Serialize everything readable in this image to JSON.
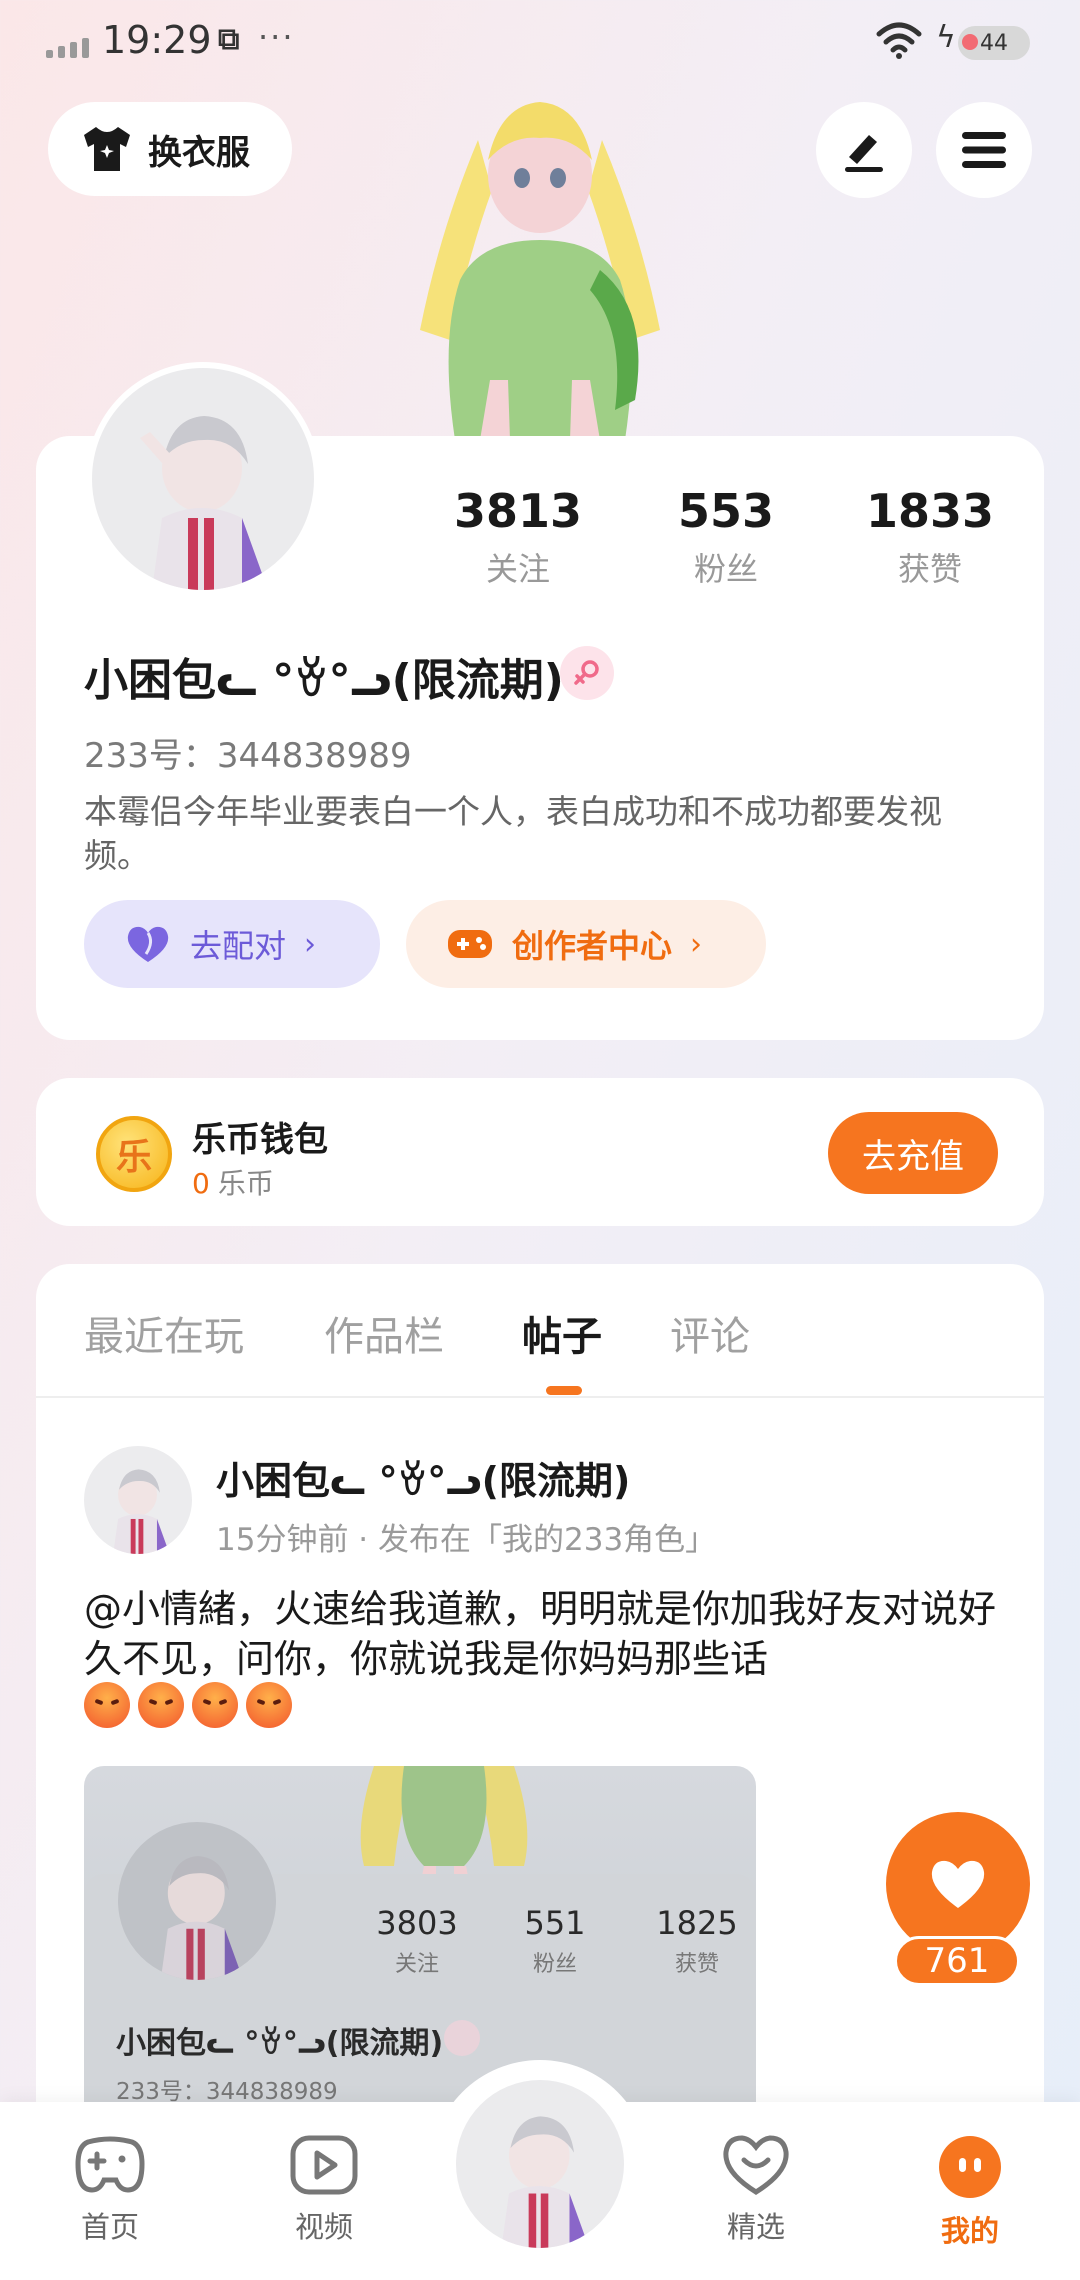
{
  "status_bar": {
    "time": "19:29",
    "battery": "44"
  },
  "top": {
    "outfit_label": "换衣服"
  },
  "profile": {
    "stats": [
      {
        "num": "3813",
        "label": "关注"
      },
      {
        "num": "553",
        "label": "粉丝"
      },
      {
        "num": "1833",
        "label": "获赞"
      }
    ],
    "name": "小困包ᓚ °ꈊ°ᓗ(限流期)",
    "uid": "233号：344838989",
    "bio": "本霉侣今年毕业要表白一个人，表白成功和不成功都要发视频。",
    "match_label": "去配对",
    "creator_label": "创作者中心"
  },
  "wallet": {
    "title": "乐币钱包",
    "amount": "0",
    "unit": "乐币",
    "coin_glyph": "乐",
    "recharge_label": "去充值"
  },
  "tabs": [
    {
      "label": "最近在玩"
    },
    {
      "label": "作品栏"
    },
    {
      "label": "帖子"
    },
    {
      "label": "评论"
    }
  ],
  "post": {
    "author": "小困包ᓚ °ꈊ°ᓗ(限流期)",
    "meta": "15分钟前 · 发布在「我的233角色」",
    "text": "@小情緒，火速给我道歉，明明就是你加我好友对说好久不见，问你，你就说我是你妈妈那些话",
    "thumb": {
      "stats": [
        {
          "num": "3803",
          "label": "关注"
        },
        {
          "num": "551",
          "label": "粉丝"
        },
        {
          "num": "1825",
          "label": "获赞"
        }
      ],
      "name": "小困包ᓚ °ꈊ°ᓗ(限流期)",
      "uid": "233号：344838989"
    }
  },
  "like": {
    "count": "761"
  },
  "nav": [
    {
      "label": "首页"
    },
    {
      "label": "视频"
    },
    {
      "label": "精选"
    },
    {
      "label": "我的"
    }
  ],
  "colors": {
    "accent": "#f6751f",
    "match": "#6c5ad8"
  }
}
